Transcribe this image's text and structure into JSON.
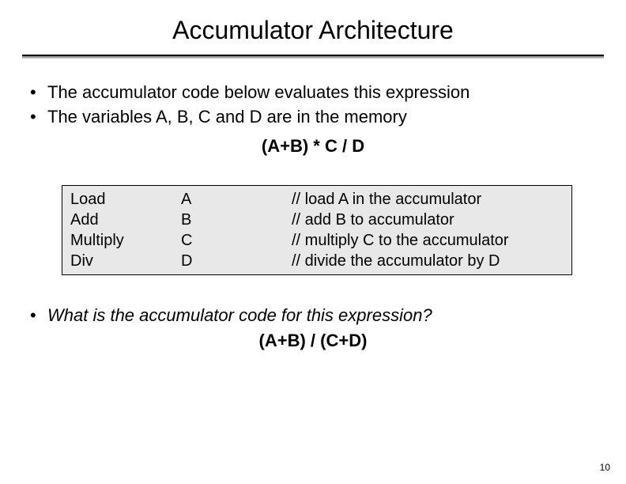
{
  "title": "Accumulator Architecture",
  "bullets": [
    "The accumulator code below evaluates this expression",
    "The variables A, B, C and D are in the memory"
  ],
  "expression1": "(A+B) * C / D",
  "code": {
    "rows": [
      {
        "op": "Load",
        "arg": "A",
        "comment": "// load A in the accumulator"
      },
      {
        "op": "Add",
        "arg": "B",
        "comment": "// add B to accumulator"
      },
      {
        "op": "Multiply",
        "arg": "C",
        "comment": "// multiply C to the accumulator"
      },
      {
        "op": "Div",
        "arg": "D",
        "comment": "// divide the accumulator by D"
      }
    ]
  },
  "question": "What is the accumulator code for this expression?",
  "expression2": "(A+B) / (C+D)",
  "page_number": "10"
}
